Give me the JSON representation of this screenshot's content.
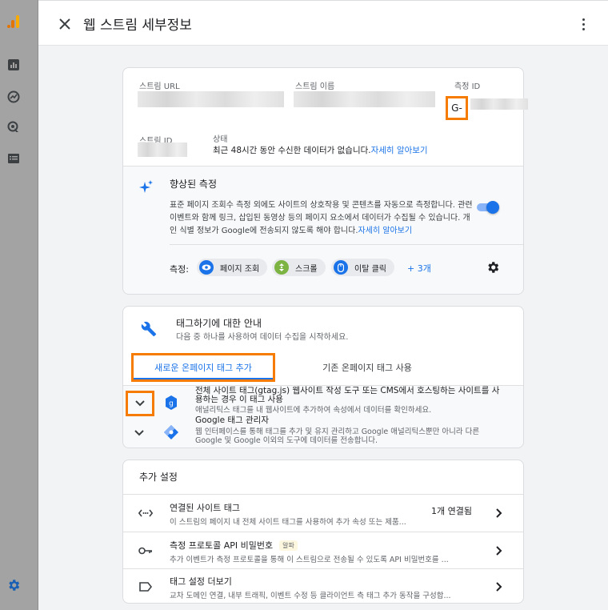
{
  "header": {
    "title": "웹 스트림 세부정보"
  },
  "stream": {
    "url_label": "스트림 URL",
    "name_label": "스트림 이름",
    "measurement_id_label": "측정 ID",
    "measurement_id_prefix": "G-",
    "id_label": "스트림 ID",
    "status_label": "상태",
    "status_text": "최근 48시간 동안 수신한 데이터가 없습니다.",
    "status_link": "자세히 알아보기"
  },
  "enhanced": {
    "title": "향상된 측정",
    "desc": "표준 페이지 조회수 측정 외에도 사이트의 상호작용 및 콘텐츠를 자동으로 측정합니다. 관련 이벤트와 함께 링크, 삽입된 동영상 등의 페이지 요소에서 데이터가 수집될 수 있습니다. 개인 식별 정보가 Google에 전송되지 않도록 해야 합니다.",
    "desc_link": "자세히 알아보기",
    "toggle_on": true,
    "measure_label": "측정:",
    "chips": [
      "페이지 조회",
      "스크롤",
      "이탈 클릭"
    ],
    "more": "+ 3개"
  },
  "tagging": {
    "title": "태그하기에 대한 안내",
    "subtitle": "다음 중 하나를 사용하여 데이터 수집을 시작하세요.",
    "tabs": [
      "새로운 온페이지 태그 추가",
      "기존 온페이지 태그 사용"
    ],
    "options": [
      {
        "title": "전체 사이트 태그(gtag.js) 웹사이트 작성 도구 또는 CMS에서 호스팅하는 사이트를 사용하는 경우 이 태그 사용",
        "desc": "애널리틱스 태그를 내 웹사이트에 추가하여 속성에서 데이터를 확인하세요."
      },
      {
        "title": "Google 태그 관리자",
        "desc": "웹 인터페이스를 통해 태그를 추가 및 유지 관리하고 Google 애널리틱스뿐만 아니라 다른 Google 및 Google 이외의 도구에 데이터를 전송합니다."
      }
    ]
  },
  "additional": {
    "title": "추가 설정",
    "rows": [
      {
        "title": "연결된 사이트 태그",
        "desc": "이 스트림의 페이지 내 전체 사이트 태그를 사용하여 추가 속성 또는 제품...",
        "count": "1개 연결됨"
      },
      {
        "title": "측정 프로토콜 API 비밀번호",
        "badge": "알파",
        "desc": "추가 이벤트가 측정 프로토콜을 통해 이 스트림으로 전송될 수 있도록 API 비밀번호를 ..."
      },
      {
        "title": "태그 설정 더보기",
        "desc": "교차 도메인 연결, 내부 트래픽, 이벤트 수정 등 클라이언트 측 태그 추가 동작을 구성합..."
      }
    ]
  },
  "colors": {
    "accent": "#1a73e8",
    "highlight": "#f57c00"
  }
}
